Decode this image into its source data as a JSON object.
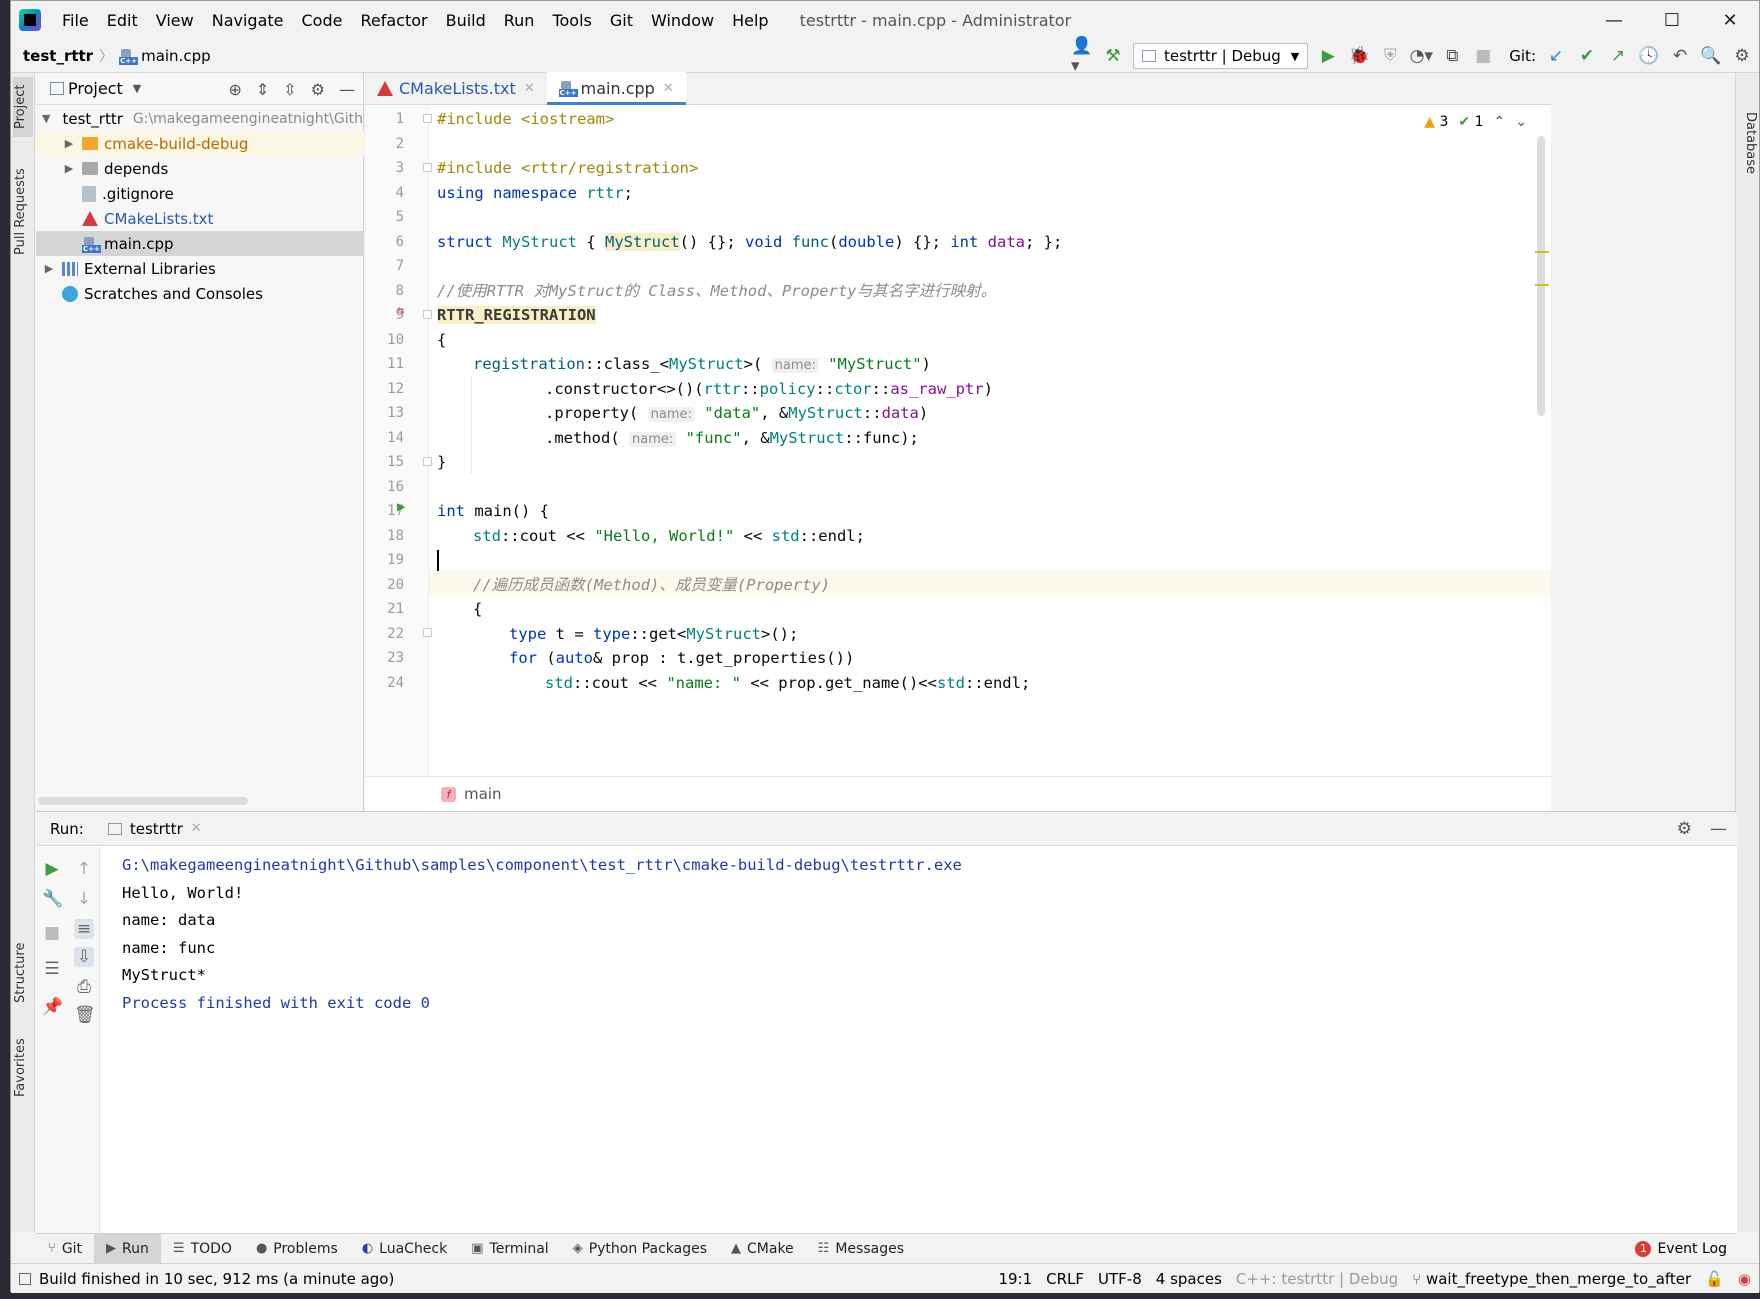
{
  "window": {
    "title": "testrttr - main.cpp - Administrator",
    "controls": {
      "minimize": "—",
      "maximize": "☐",
      "close": "✕"
    }
  },
  "menu": [
    "File",
    "Edit",
    "View",
    "Navigate",
    "Code",
    "Refactor",
    "Build",
    "Run",
    "Tools",
    "Git",
    "Window",
    "Help"
  ],
  "navbar": {
    "project": "test_rttr",
    "file": "main.cpp",
    "run_config": "testrttr | Debug",
    "git_label": "Git:"
  },
  "tool_strips": {
    "left": [
      "Project",
      "Pull Requests",
      "Structure",
      "Favorites"
    ],
    "right": [
      "Database"
    ]
  },
  "project_panel": {
    "title": "Project",
    "tree": [
      {
        "label": "test_rttr",
        "path": "G:\\makegameengineatnight\\Github",
        "expanded": true
      },
      {
        "label": "cmake-build-debug"
      },
      {
        "label": "depends"
      },
      {
        "label": ".gitignore"
      },
      {
        "label": "CMakeLists.txt"
      },
      {
        "label": "main.cpp"
      },
      {
        "label": "External Libraries"
      },
      {
        "label": "Scratches and Consoles"
      }
    ]
  },
  "editor": {
    "tabs": [
      {
        "label": "CMakeLists.txt",
        "active": false
      },
      {
        "label": "main.cpp",
        "active": true
      }
    ],
    "inspections": {
      "warnings": "3",
      "weak_warnings": "1"
    },
    "breadcrumb": "main",
    "line_numbers": [
      "1",
      "2",
      "3",
      "4",
      "5",
      "6",
      "7",
      "8",
      "9",
      "10",
      "11",
      "12",
      "13",
      "14",
      "15",
      "16",
      "17",
      "18",
      "19",
      "20",
      "21",
      "22",
      "23",
      "24"
    ],
    "code": {
      "l1_pp": "#include",
      "l1_rest": " <iostream>",
      "l3_pp": "#include",
      "l3_rest": " <rttr/registration>",
      "l4_kw1": "using",
      "l4_kw2": " namespace",
      "l4_ns": " rttr",
      "l4_end": ";",
      "l6_kw": "struct",
      "l6_cls": " MyStruct",
      "l6_a": " { ",
      "l6_ctor": "MyStruct",
      "l6_b": "() {}; ",
      "l6_void": "void",
      "l6_func": " func",
      "l6_c": "(",
      "l6_double": "double",
      "l6_d": ") {}; ",
      "l6_int": "int",
      "l6_data": " data",
      "l6_e": "; };",
      "l8": "//使用RTTR 对MyStruct的 Class、Method、Property与其名字进行映射。",
      "l9": "RTTR_REGISTRATION",
      "l10": "{",
      "l11_fn": "registration",
      "l11_a": "::class_<",
      "l11_cls": "MyStruct",
      "l11_b": ">( ",
      "l11_hint": "name:",
      "l11_str": " \"MyStruct\"",
      "l11_c": ")",
      "l12_a": ".constructor<>()(",
      "l12_ns1": "rttr",
      "l12_s1": "::",
      "l12_ns2": "policy",
      "l12_s2": "::",
      "l12_ns3": "ctor",
      "l12_s3": "::",
      "l12_mem": "as_raw_ptr",
      "l12_b": ")",
      "l13_a": ".property( ",
      "l13_hint": "name:",
      "l13_str": " \"data\"",
      "l13_b": ", &",
      "l13_cls": "MyStruct",
      "l13_c": "::",
      "l13_mem": "data",
      "l13_d": ")",
      "l14_a": ".method( ",
      "l14_hint": "name:",
      "l14_str": " \"func\"",
      "l14_b": ", &",
      "l14_cls": "MyStruct",
      "l14_c": "::func);",
      "l15": "}",
      "l17_int": "int",
      "l17_rest": " main() {",
      "l18_ns": "std",
      "l18_a": "::cout << ",
      "l18_str": "\"Hello, World!\"",
      "l18_b": " << ",
      "l18_ns2": "std",
      "l18_c": "::endl;",
      "l20": "//遍历成员函数(Method)、成员变量(Property)",
      "l21": "{",
      "l22_ty": "type",
      "l22_a": " t = ",
      "l22_ty2": "type",
      "l22_b": "::get<",
      "l22_cls": "MyStruct",
      "l22_c": ">();",
      "l23_kw": "for",
      "l23_a": " (",
      "l23_kw2": "auto",
      "l23_b": "& prop : t.get_properties())",
      "l24_ns": "std",
      "l24_a": "::cout << ",
      "l24_str": "\"name: \"",
      "l24_b": " << prop.get_name()<<",
      "l24_ns2": "std",
      "l24_c": "::endl;"
    }
  },
  "run_panel": {
    "label": "Run:",
    "tab": "testrttr",
    "console": [
      "G:\\makegameengineatnight\\Github\\samples\\component\\test_rttr\\cmake-build-debug\\testrttr.exe",
      "Hello, World!",
      "name: data",
      "name: func",
      "MyStruct*",
      "",
      "Process finished with exit code 0"
    ]
  },
  "tool_windows": [
    "Git",
    "Run",
    "TODO",
    "Problems",
    "LuaCheck",
    "Terminal",
    "Python Packages",
    "CMake",
    "Messages"
  ],
  "event_log": {
    "label": "Event Log",
    "count": "1"
  },
  "status_bar": {
    "message": "Build finished in 10 sec, 912 ms (a minute ago)",
    "position": "19:1",
    "line_sep": "CRLF",
    "encoding": "UTF-8",
    "indent": "4 spaces",
    "context": "C++: testrttr | Debug",
    "branch": "wait_freetype_then_merge_to_after"
  },
  "colors": {
    "accent": "#4083c9",
    "keyword": "#0033b3",
    "string": "#067d17",
    "comment": "#8c8c8c",
    "run_green": "#3d9c3d"
  }
}
